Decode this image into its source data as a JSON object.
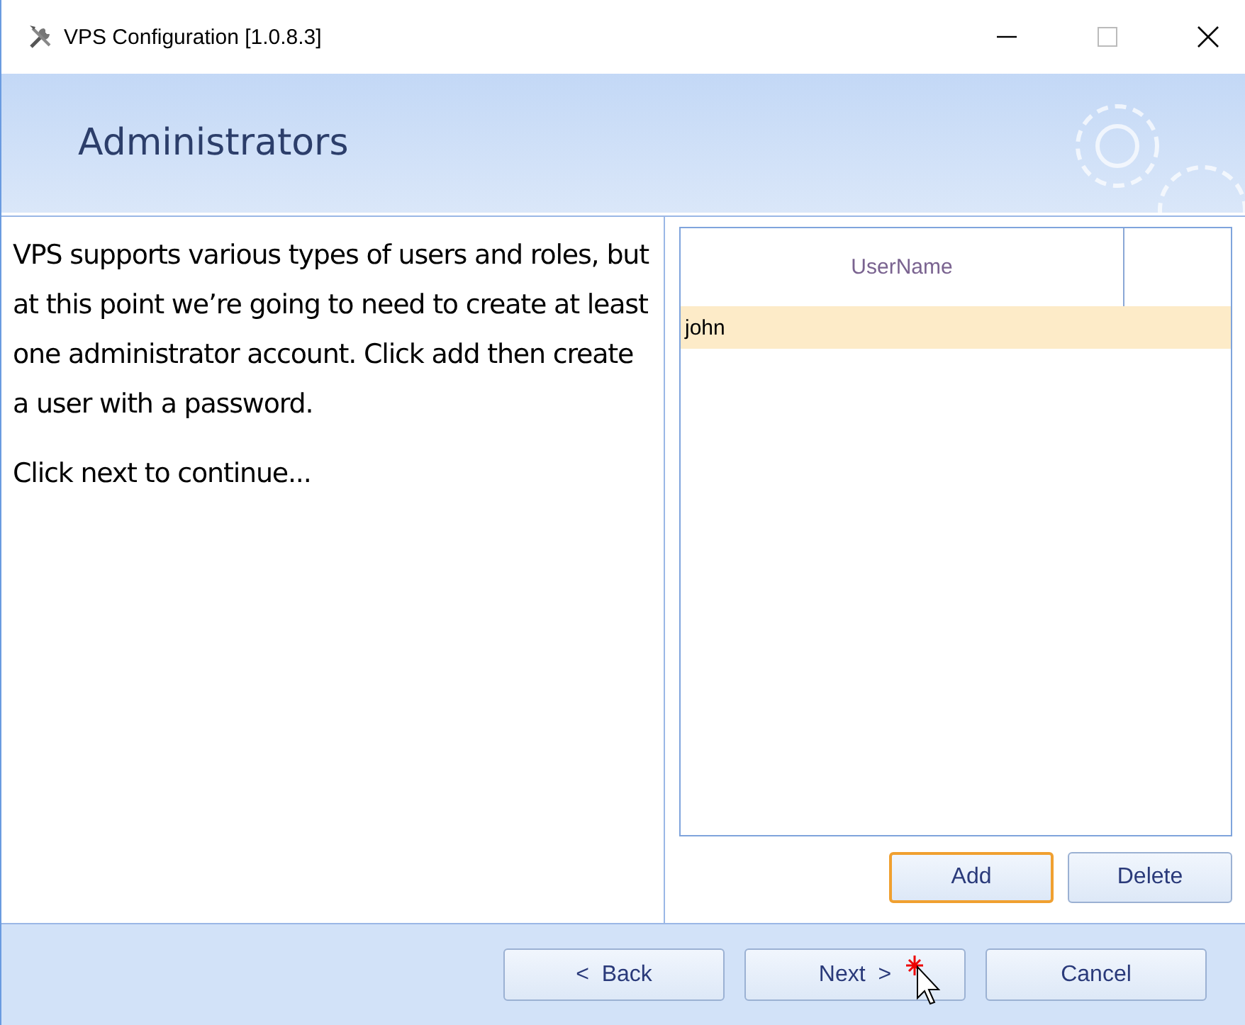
{
  "window": {
    "title": "VPS Configuration [1.0.8.3]"
  },
  "header": {
    "title": "Administrators"
  },
  "description": [
    "VPS supports various types of users and roles, but at this point we’re going to need to create at least one administrator account. Click add then create a user with a password.",
    "Click next to continue..."
  ],
  "table": {
    "columns": [
      "UserName"
    ],
    "rows": [
      {
        "cells": [
          "john"
        ],
        "selected": true
      }
    ]
  },
  "grid_buttons": [
    {
      "label": "Add",
      "focused": true
    },
    {
      "label": "Delete",
      "focused": false
    }
  ],
  "footer_buttons": [
    {
      "label": "<  Back"
    },
    {
      "label": "Next  >"
    },
    {
      "label": "Cancel"
    }
  ]
}
